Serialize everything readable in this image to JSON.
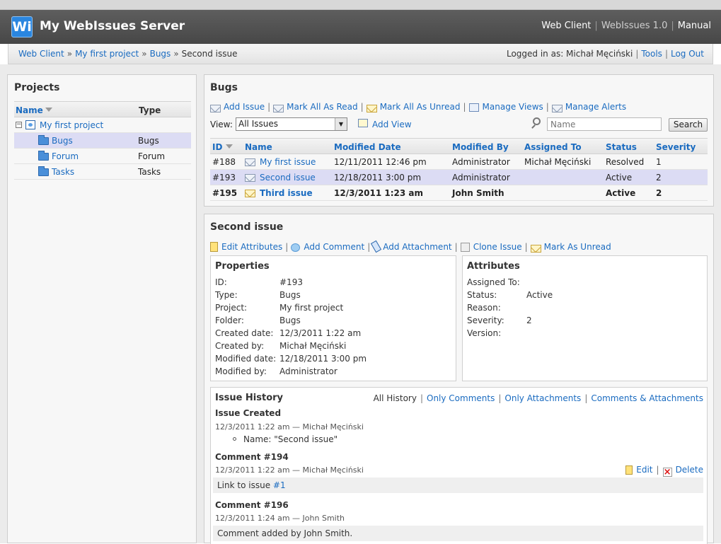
{
  "app": {
    "logo_text": "Wi",
    "title": "My WebIssues Server",
    "top_links": [
      "Web Client",
      "WebIssues 1.0",
      "Manual"
    ]
  },
  "breadcrumb": {
    "items": [
      "Web Client",
      "My first project",
      "Bugs"
    ],
    "current": "Second issue"
  },
  "login": {
    "text": "Logged in as: Michał Męciński",
    "tools": "Tools",
    "logout": "Log Out"
  },
  "projects": {
    "title": "Projects",
    "col_name": "Name",
    "col_type": "Type",
    "project": "My first project",
    "folders": [
      {
        "name": "Bugs",
        "type": "Bugs"
      },
      {
        "name": "Forum",
        "type": "Forum"
      },
      {
        "name": "Tasks",
        "type": "Tasks"
      }
    ]
  },
  "bugs": {
    "title": "Bugs",
    "actions": [
      "Add Issue",
      "Mark All As Read",
      "Mark All As Unread",
      "Manage Views",
      "Manage Alerts"
    ],
    "view_label": "View:",
    "view_value": "All Issues",
    "add_view": "Add View",
    "search_placeholder": "Name",
    "search_button": "Search",
    "columns": [
      "ID",
      "Name",
      "Modified Date",
      "Modified By",
      "Assigned To",
      "Status",
      "Severity"
    ],
    "rows": [
      {
        "id": "#188",
        "name": "My first issue",
        "modified": "12/11/2011 12:46 pm",
        "by": "Administrator",
        "assigned": "Michał Męciński",
        "status": "Resolved",
        "severity": "1"
      },
      {
        "id": "#193",
        "name": "Second issue",
        "modified": "12/18/2011 3:00 pm",
        "by": "Administrator",
        "assigned": "",
        "status": "Active",
        "severity": "2"
      },
      {
        "id": "#195",
        "name": "Third issue",
        "modified": "12/3/2011 1:23 am",
        "by": "John Smith",
        "assigned": "",
        "status": "Active",
        "severity": "2"
      }
    ]
  },
  "issue": {
    "title": "Second issue",
    "actions": [
      "Edit Attributes",
      "Add Comment",
      "Add Attachment",
      "Clone Issue",
      "Mark As Unread"
    ],
    "properties_title": "Properties",
    "properties": [
      {
        "k": "ID:",
        "v": "#193"
      },
      {
        "k": "Type:",
        "v": "Bugs"
      },
      {
        "k": "Project:",
        "v": "My first project"
      },
      {
        "k": "Folder:",
        "v": "Bugs"
      },
      {
        "k": "Created date:",
        "v": "12/3/2011 1:22 am"
      },
      {
        "k": "Created by:",
        "v": "Michał Męciński"
      },
      {
        "k": "Modified date:",
        "v": "12/18/2011 3:00 pm"
      },
      {
        "k": "Modified by:",
        "v": "Administrator"
      }
    ],
    "attributes_title": "Attributes",
    "attributes": [
      {
        "k": "Assigned To:",
        "v": ""
      },
      {
        "k": "Status:",
        "v": "Active"
      },
      {
        "k": "Reason:",
        "v": ""
      },
      {
        "k": "Severity:",
        "v": "2"
      },
      {
        "k": "Version:",
        "v": ""
      }
    ],
    "history": {
      "title": "Issue History",
      "filters": [
        "All History",
        "Only Comments",
        "Only Attachments",
        "Comments & Attachments"
      ],
      "created_title": "Issue Created",
      "created_meta": "12/3/2011 1:22 am — Michał Męciński",
      "created_change": "Name: \"Second issue\"",
      "comment1_title": "Comment #194",
      "comment1_meta": "12/3/2011 1:22 am — Michał Męciński",
      "comment1_body_prefix": "Link to issue ",
      "comment1_link": "#1",
      "edit": "Edit",
      "delete": "Delete",
      "comment2_title": "Comment #196",
      "comment2_meta": "12/3/2011 1:24 am — John Smith",
      "comment2_body": "Comment added by John Smith."
    }
  },
  "colors": {
    "link": "#1a6bc0",
    "header": "#4f4f4f",
    "selected_row": "#dcdcf4"
  }
}
